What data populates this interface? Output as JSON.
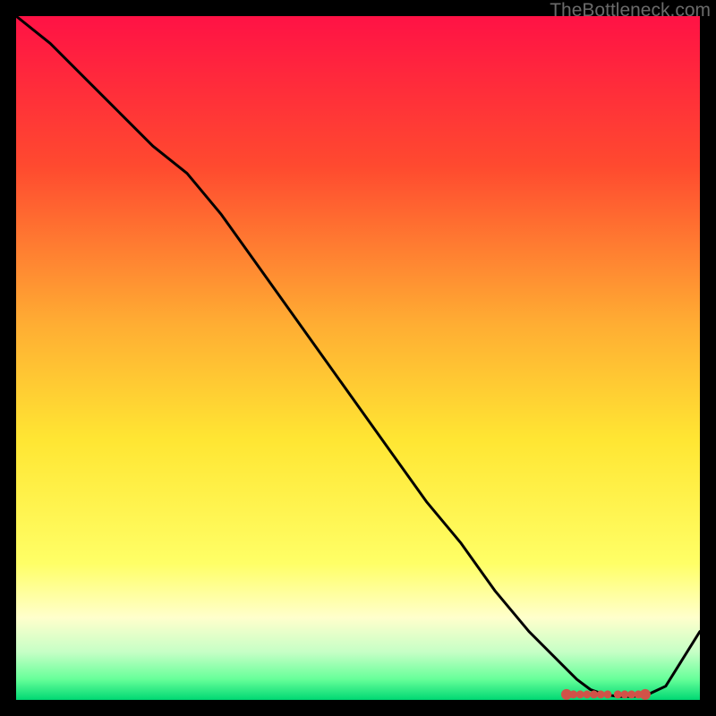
{
  "attribution": "TheBottleneck.com",
  "colors": {
    "top": "#ff1245",
    "red": "#ff3030",
    "orange": "#ff9933",
    "yellow": "#ffe633",
    "lightyellow": "#ffff99",
    "palegreen": "#c6ffc6",
    "green": "#00d873",
    "curve": "#000000",
    "marker": "#d15248",
    "background": "#000000"
  },
  "chart_data": {
    "type": "line",
    "title": "",
    "xlabel": "",
    "ylabel": "",
    "xlim": [
      0,
      100
    ],
    "ylim": [
      0,
      100
    ],
    "x": [
      0,
      5,
      10,
      15,
      20,
      25,
      30,
      35,
      40,
      45,
      50,
      55,
      60,
      65,
      70,
      75,
      80,
      82,
      84,
      86,
      88,
      90,
      92,
      95,
      100
    ],
    "values": [
      100,
      96,
      91,
      86,
      81,
      77,
      71,
      64,
      57,
      50,
      43,
      36,
      29,
      23,
      16,
      10,
      5,
      3,
      1.5,
      0.8,
      0.5,
      0.5,
      0.6,
      2,
      10
    ],
    "markers_x": [
      80.5,
      81.5,
      82.5,
      83.5,
      84.5,
      85.5,
      86.5,
      88.0,
      89.0,
      90.0,
      91.0,
      92.0
    ],
    "markers_y": [
      0.8,
      0.8,
      0.8,
      0.8,
      0.8,
      0.8,
      0.8,
      0.8,
      0.8,
      0.8,
      0.8,
      0.8
    ],
    "gradient_stops": [
      {
        "offset": 0,
        "color": "#ff1245"
      },
      {
        "offset": 22,
        "color": "#ff4a2f"
      },
      {
        "offset": 45,
        "color": "#ffad33"
      },
      {
        "offset": 62,
        "color": "#ffe633"
      },
      {
        "offset": 80,
        "color": "#ffff66"
      },
      {
        "offset": 88,
        "color": "#ffffcc"
      },
      {
        "offset": 93,
        "color": "#c6ffc6"
      },
      {
        "offset": 97,
        "color": "#66ff99"
      },
      {
        "offset": 100,
        "color": "#00d873"
      }
    ]
  }
}
